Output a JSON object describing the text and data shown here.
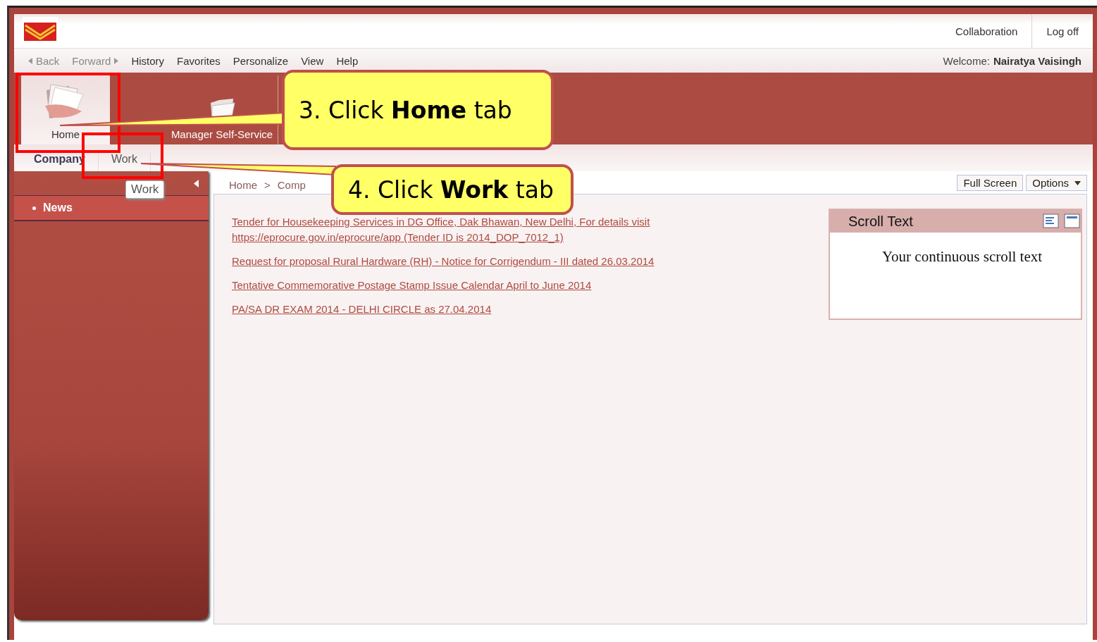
{
  "header": {
    "links": [
      "Collaboration",
      "Log off"
    ]
  },
  "nav": {
    "back": "Back",
    "forward": "Forward",
    "menu": [
      "History",
      "Favorites",
      "Personalize",
      "View",
      "Help"
    ],
    "welcome_label": "Welcome:",
    "user": "Nairatya Vaisingh"
  },
  "top_tabs": [
    {
      "label": "Home",
      "selected": true,
      "kind": "papers"
    },
    {
      "label": "Manager Self-Service",
      "selected": false,
      "kind": "folder"
    }
  ],
  "sub_tabs": [
    {
      "label": "Company",
      "selected": true
    },
    {
      "label": "Work",
      "selected": false
    }
  ],
  "tooltip": "Work",
  "sidebar": {
    "items": [
      {
        "label": "News",
        "selected": true
      }
    ]
  },
  "breadcrumb": [
    "Home",
    ">",
    "Comp"
  ],
  "toolbar": {
    "buttons": [
      "Full Screen"
    ],
    "menu": "Options"
  },
  "news": [
    "Tender for Housekeeping Services in DG Office, Dak Bhawan, New Delhi, For details visit https://eprocure.gov.in/eprocure/app (Tender ID is 2014_DOP_7012_1)",
    "Request for proposal Rural Hardware (RH) - Notice for Corrigendum - III dated 26.03.2014",
    "Tentative Commemorative Postage Stamp Issue Calendar April to June 2014",
    "PA/SA DR EXAM 2014 - DELHI CIRCLE as 27.04.2014"
  ],
  "widget": {
    "title": "Scroll Text",
    "text": "Your continuous scroll text"
  },
  "callouts": [
    "3. Click **Home** tab",
    "4. Click **Work** tab"
  ]
}
